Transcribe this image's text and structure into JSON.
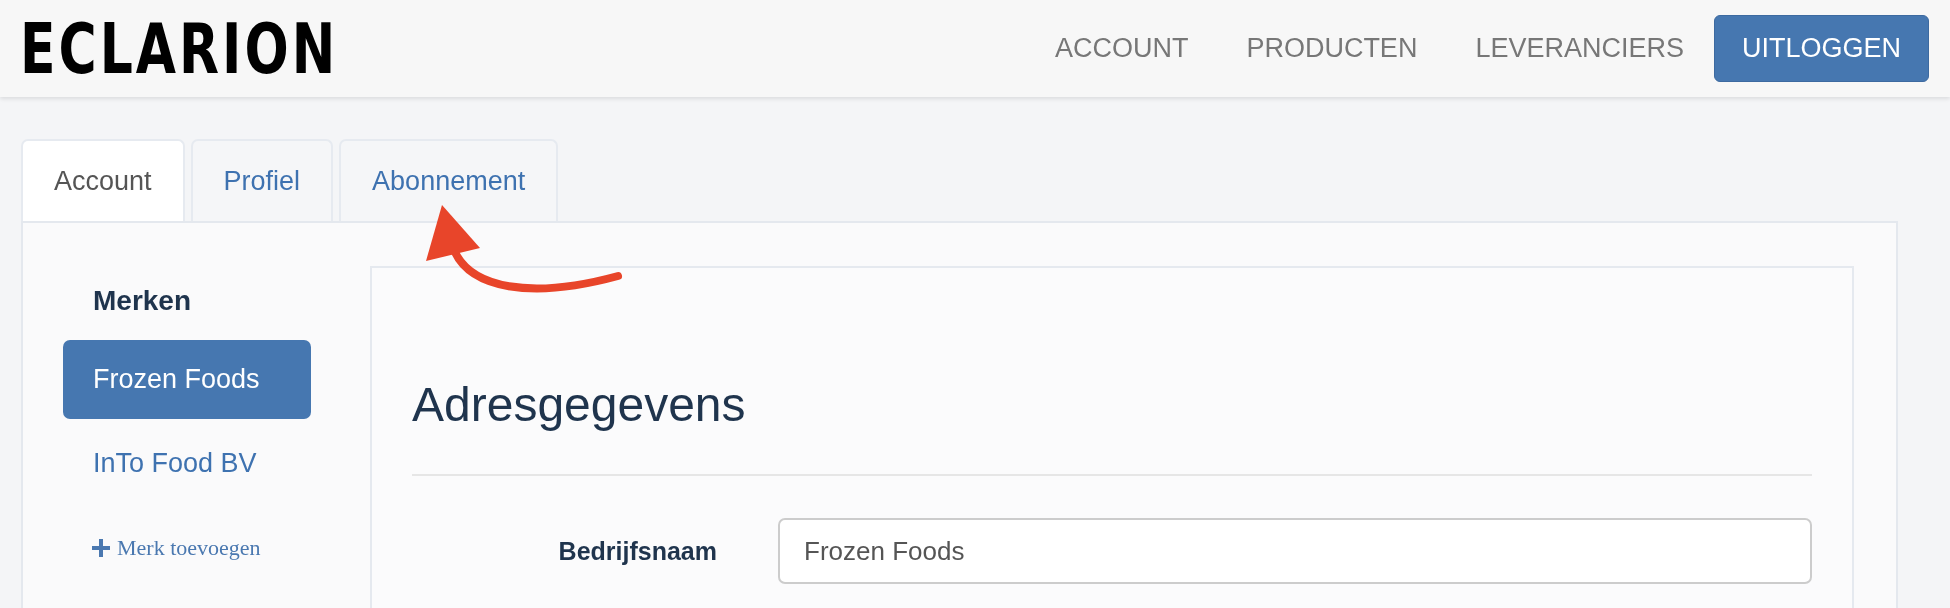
{
  "header": {
    "logo": "ECLARION",
    "nav": [
      {
        "label": "ACCOUNT"
      },
      {
        "label": "PRODUCTEN"
      },
      {
        "label": "LEVERANCIERS"
      }
    ],
    "logout_button": "UITLOGGEN"
  },
  "tabs": [
    {
      "label": "Account",
      "selected": true
    },
    {
      "label": "Profiel",
      "selected": false
    },
    {
      "label": "Abonnement",
      "selected": false
    }
  ],
  "sidebar": {
    "title": "Merken",
    "items": [
      {
        "label": "Frozen Foods",
        "selected": true
      },
      {
        "label": "InTo Food BV",
        "selected": false
      }
    ],
    "add_link": "Merk toevoegen"
  },
  "form": {
    "title": "Adresgegevens",
    "fields": [
      {
        "label": "Bedrijfsnaam",
        "value": "Frozen Foods"
      }
    ]
  }
}
